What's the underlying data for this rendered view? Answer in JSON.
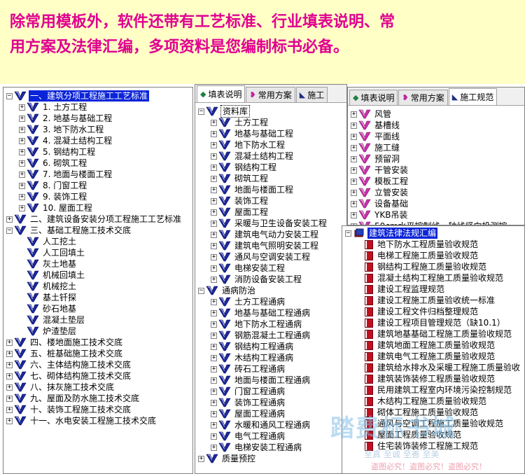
{
  "banner": {
    "line1": "除常用模板外，软件还带有工艺标准、行业填表说明、常",
    "line2": "用方案及法律汇编，多项资料是您编制标书必备。"
  },
  "colors": {
    "banner_bg": "#ffffc6",
    "banner_text": "#e00090",
    "selection": "#0a24d8"
  },
  "panel1": {
    "items": [
      {
        "level": 0,
        "expander": "−",
        "label": "一、建筑分项工程施工工艺标准",
        "selected": true
      },
      {
        "level": 1,
        "expander": "+",
        "label": "1. 土方工程"
      },
      {
        "level": 1,
        "expander": "+",
        "label": "2. 地基与基础工程"
      },
      {
        "level": 1,
        "expander": "+",
        "label": "3. 地下防水工程"
      },
      {
        "level": 1,
        "expander": "+",
        "label": "4. 混凝土结构工程"
      },
      {
        "level": 1,
        "expander": "+",
        "label": "5. 钢结构工程"
      },
      {
        "level": 1,
        "expander": "+",
        "label": "6. 砌筑工程"
      },
      {
        "level": 1,
        "expander": "+",
        "label": "7. 地面与楼面工程"
      },
      {
        "level": 1,
        "expander": "+",
        "label": "8. 门窗工程"
      },
      {
        "level": 1,
        "expander": "+",
        "label": "9. 装饰工程"
      },
      {
        "level": 1,
        "expander": "+",
        "label": "10. 屋面工程"
      },
      {
        "level": 0,
        "expander": "+",
        "label": "二、建筑设备安装分项工程施工工艺标准"
      },
      {
        "level": 0,
        "expander": "−",
        "label": "三、基础工程施工技术交底"
      },
      {
        "level": 1,
        "expander": "",
        "label": "人工挖土"
      },
      {
        "level": 1,
        "expander": "",
        "label": "人工回填土"
      },
      {
        "level": 1,
        "expander": "",
        "label": "灰土地基"
      },
      {
        "level": 1,
        "expander": "",
        "label": "机械回填土"
      },
      {
        "level": 1,
        "expander": "",
        "label": "机械挖土"
      },
      {
        "level": 1,
        "expander": "",
        "label": "基土钎探"
      },
      {
        "level": 1,
        "expander": "",
        "label": "砂石地基"
      },
      {
        "level": 1,
        "expander": "",
        "label": "混凝土垫层"
      },
      {
        "level": 1,
        "expander": "",
        "label": "炉渣垫层"
      },
      {
        "level": 0,
        "expander": "+",
        "label": "四、楼地面施工技术交底"
      },
      {
        "level": 0,
        "expander": "+",
        "label": "五、桩基础施工技术交底"
      },
      {
        "level": 0,
        "expander": "+",
        "label": "六、主体结构施工技术交底"
      },
      {
        "level": 0,
        "expander": "+",
        "label": "七、砌体结构施工技术交底"
      },
      {
        "level": 0,
        "expander": "+",
        "label": "八、抹灰施工技术交底"
      },
      {
        "level": 0,
        "expander": "+",
        "label": "九、屋面及防水施工技术交底"
      },
      {
        "level": 0,
        "expander": "+",
        "label": "十、装饰工程施工技术交底"
      },
      {
        "level": 0,
        "expander": "+",
        "label": "十一、水电安装工程施工技术交底"
      }
    ]
  },
  "panel2": {
    "tabs": [
      {
        "icon": "◆",
        "label": "填表说明",
        "active": true
      },
      {
        "icon": "❥",
        "label": "常用方案"
      },
      {
        "icon": "◣",
        "label": "施工"
      }
    ],
    "items": [
      {
        "level": 0,
        "expander": "−",
        "label": "资料库",
        "boxed": true
      },
      {
        "level": 1,
        "expander": "+",
        "label": "土方工程"
      },
      {
        "level": 1,
        "expander": "+",
        "label": "地基与基础工程"
      },
      {
        "level": 1,
        "expander": "+",
        "label": "地下防水工程"
      },
      {
        "level": 1,
        "expander": "+",
        "label": "混凝土结构工程"
      },
      {
        "level": 1,
        "expander": "+",
        "label": "钢结构工程"
      },
      {
        "level": 1,
        "expander": "+",
        "label": "砌筑工程"
      },
      {
        "level": 1,
        "expander": "+",
        "label": "地面与楼面工程"
      },
      {
        "level": 1,
        "expander": "+",
        "label": "装饰工程"
      },
      {
        "level": 1,
        "expander": "+",
        "label": "屋面工程"
      },
      {
        "level": 1,
        "expander": "+",
        "label": "采暖与卫生设备安装工程"
      },
      {
        "level": 1,
        "expander": "+",
        "label": "建筑电气动力安装工程"
      },
      {
        "level": 1,
        "expander": "+",
        "label": "建筑电气照明安装工程"
      },
      {
        "level": 1,
        "expander": "+",
        "label": "通风与空调安装工程"
      },
      {
        "level": 1,
        "expander": "+",
        "label": "电梯安装工程"
      },
      {
        "level": 1,
        "expander": "+",
        "label": "消防设备安装工程"
      },
      {
        "level": 0,
        "expander": "−",
        "label": "通病防治"
      },
      {
        "level": 1,
        "expander": "+",
        "label": "土方工程通病"
      },
      {
        "level": 1,
        "expander": "+",
        "label": "地基与基础工程通病"
      },
      {
        "level": 1,
        "expander": "+",
        "label": "地下防水工程通病"
      },
      {
        "level": 1,
        "expander": "+",
        "label": "钢筋混凝土工程通病"
      },
      {
        "level": 1,
        "expander": "+",
        "label": "钢结构工程通病"
      },
      {
        "level": 1,
        "expander": "+",
        "label": "木结构工程通病"
      },
      {
        "level": 1,
        "expander": "+",
        "label": "砖石工程通病"
      },
      {
        "level": 1,
        "expander": "+",
        "label": "地面与楼面工程通病"
      },
      {
        "level": 1,
        "expander": "+",
        "label": "门窗工程通病"
      },
      {
        "level": 1,
        "expander": "+",
        "label": "装饰工程通病"
      },
      {
        "level": 1,
        "expander": "+",
        "label": "屋面工程通病"
      },
      {
        "level": 1,
        "expander": "+",
        "label": "水暖和通风工程通病"
      },
      {
        "level": 1,
        "expander": "+",
        "label": "电气工程通病"
      },
      {
        "level": 1,
        "expander": "+",
        "label": "电梯安装工程通病"
      },
      {
        "level": 0,
        "expander": "+",
        "label": "质量预控"
      }
    ]
  },
  "panel3": {
    "tabs": [
      {
        "icon": "◆",
        "label": "填表说明"
      },
      {
        "icon": "❥",
        "label": "常用方案"
      },
      {
        "icon": "◣",
        "label": "施工规范",
        "active": true
      }
    ],
    "items": [
      {
        "level": 0,
        "expander": "+",
        "label": "风管"
      },
      {
        "level": 0,
        "expander": "+",
        "label": "基槽线"
      },
      {
        "level": 0,
        "expander": "+",
        "label": "平面线"
      },
      {
        "level": 0,
        "expander": "+",
        "label": "施工缝"
      },
      {
        "level": 0,
        "expander": "+",
        "label": "预留洞"
      },
      {
        "level": 0,
        "expander": "+",
        "label": "干管安装"
      },
      {
        "level": 0,
        "expander": "+",
        "label": "模板工程"
      },
      {
        "level": 0,
        "expander": "+",
        "label": "立管安装"
      },
      {
        "level": 0,
        "expander": "+",
        "label": "设备基础"
      },
      {
        "level": 0,
        "expander": "+",
        "label": "YKB吊装"
      },
      {
        "level": 0,
        "expander": "+",
        "label": "50cm水平控制线、轴线竖向投测控"
      }
    ]
  },
  "panel4": {
    "root": "建筑法律法规汇编",
    "items": [
      "地下防水工程质量验收规范",
      "电梯工程施工质量验收规范",
      "钢结构工程施工质量验收规范",
      "混凝土结构工程施工质量验收规范",
      "建设工程监理规范",
      "建设工程施工质量验收统一标准",
      "建设工程文件归档整理规范",
      "建设工程项目管理规范（缺10.1）",
      "建筑地基基础工程施工质量验收规范",
      "建筑地面工程施工质量验收规范",
      "建筑电气工程施工质量验收规范",
      "建筑给水排水及采暖工程施工质量验收",
      "建筑装饰装修工程质量验收规范",
      "民用建筑工程室内环境污染控制规范",
      "木结构工程施工质量验收规范",
      "砌体工程施工质量验收规范",
      "通风与空调工程施工质量验收规范",
      "屋面工程质量验收规范",
      "住宅装饰装修工程施工规范"
    ]
  },
  "watermark": {
    "main": "踏费标书城",
    "sub": "至真 至诚  至善 至美",
    "notice": "盗图必究！盗图必究！盗图必究！"
  }
}
